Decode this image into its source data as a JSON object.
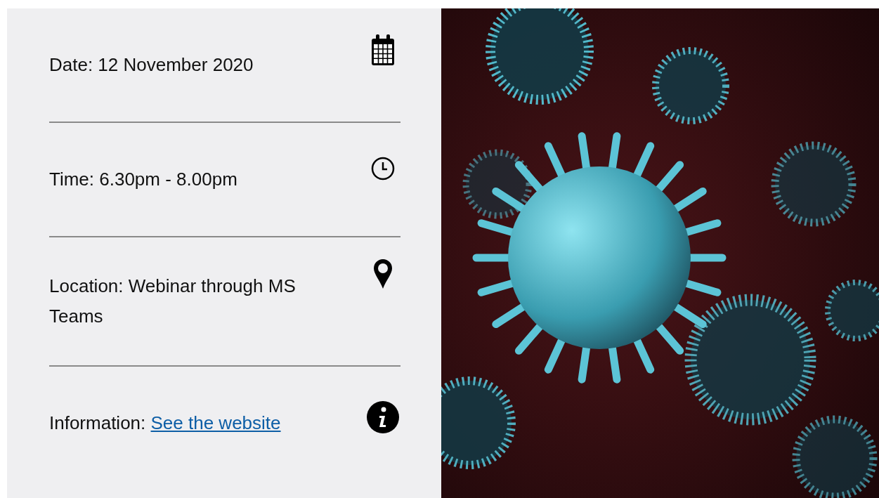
{
  "details": [
    {
      "kind": "date",
      "text": "Date: 12 November 2020"
    },
    {
      "kind": "time",
      "text": "Time: 6.30pm - 8.00pm"
    },
    {
      "kind": "location",
      "text": "Location: Webinar through MS Teams"
    },
    {
      "kind": "info",
      "text": "Information: ",
      "link": "See the website"
    }
  ]
}
